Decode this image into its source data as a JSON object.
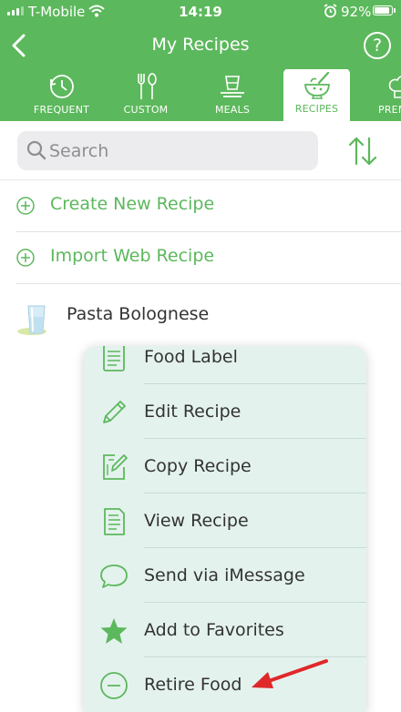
{
  "status_bar": {
    "carrier": "T-Mobile",
    "time": "14:19",
    "battery_percent": "92%",
    "battery_level": 0.92
  },
  "nav": {
    "title": "My Recipes",
    "help_label": "?",
    "back_icon": "chevron-left-icon"
  },
  "tabs": [
    {
      "label": "FREQUENT",
      "icon": "history-clock-icon",
      "active": false
    },
    {
      "label": "CUSTOM",
      "icon": "fork-spoon-icon",
      "active": false
    },
    {
      "label": "MEALS",
      "icon": "plate-cup-icon",
      "active": false
    },
    {
      "label": "RECIPES",
      "icon": "mortar-bowl-icon",
      "active": true
    },
    {
      "label": "PREM",
      "icon": "chef-hat-icon",
      "active": false
    }
  ],
  "search": {
    "placeholder": "Search",
    "value": ""
  },
  "actions": {
    "create": "Create New Recipe",
    "import": "Import Web Recipe"
  },
  "recipes": [
    {
      "name": "Pasta Bolognese"
    }
  ],
  "context_menu": {
    "items": [
      {
        "label": "Food Label",
        "icon": "nutrition-label-icon"
      },
      {
        "label": "Edit Recipe",
        "icon": "pencil-icon"
      },
      {
        "label": "Copy Recipe",
        "icon": "copy-edit-icon"
      },
      {
        "label": "View Recipe",
        "icon": "document-icon"
      },
      {
        "label": "Send via iMessage",
        "icon": "chat-bubble-icon"
      },
      {
        "label": "Add to Favorites",
        "icon": "star-icon"
      },
      {
        "label": "Retire Food",
        "icon": "minus-circle-icon"
      }
    ]
  },
  "colors": {
    "brand_green": "#5cb85c",
    "menu_background": "#e4f2ee",
    "annotation_arrow": "#e0282a"
  }
}
